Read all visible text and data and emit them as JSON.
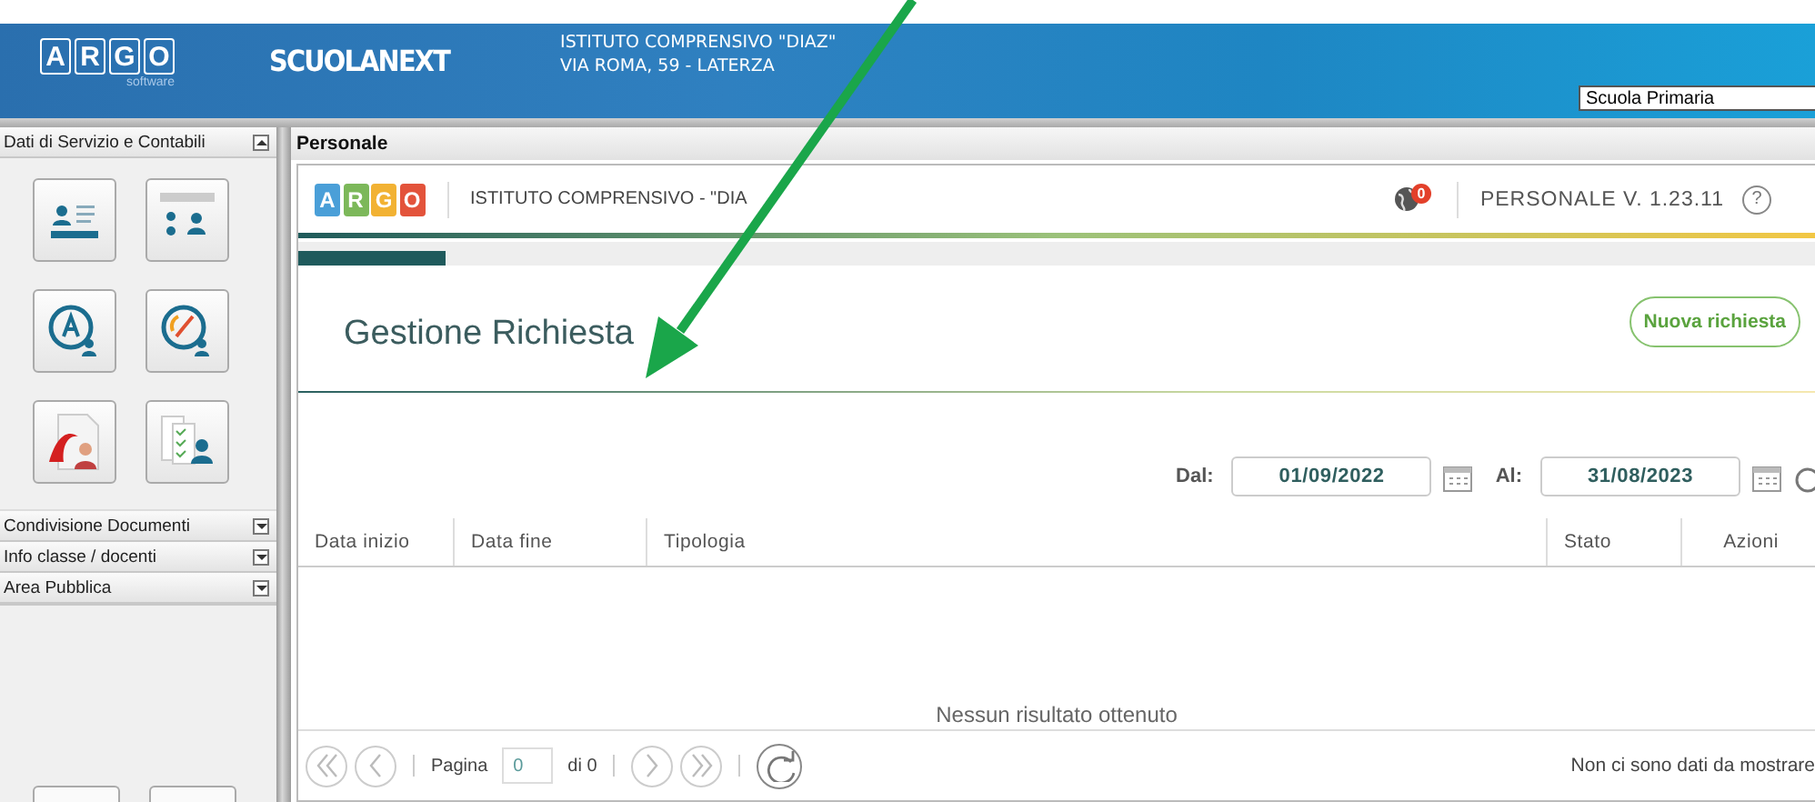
{
  "header": {
    "logo_letters": [
      "A",
      "R",
      "G",
      "O"
    ],
    "logo_sub": "software",
    "product": "SCUOLANEXT",
    "institute_lines": [
      "ISTITUTO COMPRENSIVO \"DIAZ\"",
      "VIA ROMA, 59 - LATERZA"
    ],
    "school_select": {
      "value": "Scuola Primaria"
    }
  },
  "sidebar": {
    "sections": [
      {
        "label": "Dati di Servizio e Contabili",
        "expanded": true,
        "tiles": [
          {
            "kind": "card"
          },
          {
            "kind": "contacts"
          },
          {
            "kind": "letter"
          },
          {
            "kind": "clock"
          },
          {
            "kind": "document"
          },
          {
            "kind": "checklist"
          }
        ]
      },
      {
        "label": "Condivisione Documenti",
        "expanded": false
      },
      {
        "label": "Info classe / docenti",
        "expanded": false
      },
      {
        "label": "Area Pubblica",
        "expanded": false
      }
    ]
  },
  "panel": {
    "title": "Personale",
    "app_bar": {
      "logo": [
        {
          "text": "A",
          "color": "#4a9fd8"
        },
        {
          "text": "R",
          "color": "#7cb85a"
        },
        {
          "text": "G",
          "color": "#f2b233"
        },
        {
          "text": "O",
          "color": "#e3533b"
        }
      ],
      "institute": "ISTITUTO COMPRENSIVO - \"DIA",
      "notifications": "0",
      "version": "PERSONALE V. 1.23.11",
      "help": "?"
    },
    "page_title": "Gestione Richiesta",
    "new_button": "Nuova richiesta",
    "filter": {
      "from_label": "Dal:",
      "from_value": "01/09/2022",
      "to_label": "Al:",
      "to_value": "31/08/2023"
    },
    "table": {
      "columns": [
        "Data inizio",
        "Data fine",
        "Tipologia",
        "Stato",
        "Azioni"
      ],
      "empty_message": "Nessun risultato ottenuto"
    },
    "pager": {
      "buttons": [
        {
          "kind": "first",
          "disabled": true
        },
        {
          "kind": "prev",
          "disabled": true
        },
        {
          "kind": "next",
          "disabled": true
        },
        {
          "kind": "last",
          "disabled": true
        },
        {
          "kind": "refresh",
          "disabled": false
        }
      ],
      "page_label": "Pagina",
      "page_value": "0",
      "of_label": "di 0",
      "message": "Non ci sono dati da mostrare"
    }
  }
}
